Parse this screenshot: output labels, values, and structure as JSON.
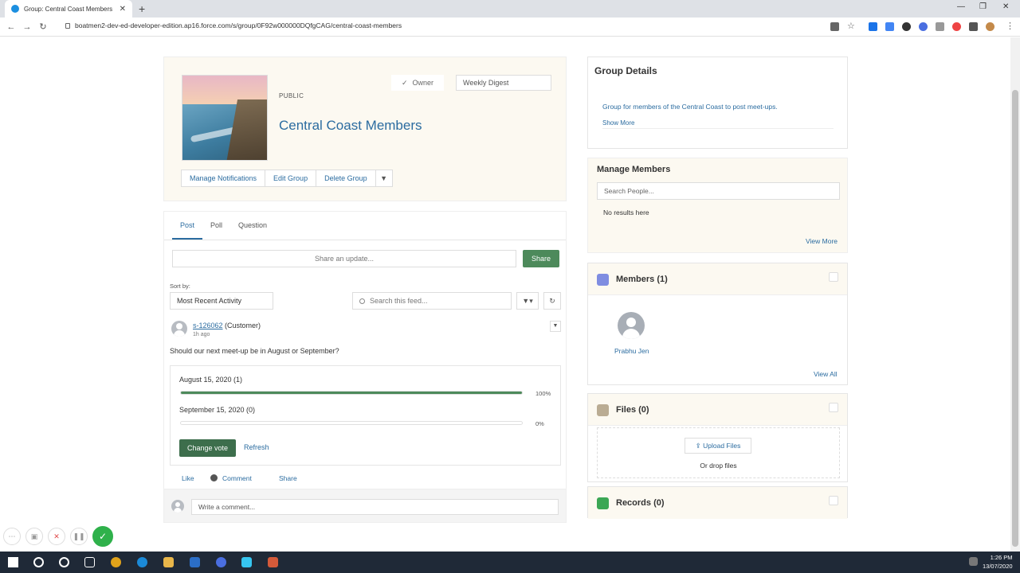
{
  "browser": {
    "tab_title": "Group: Central Coast Members",
    "url": "boatmen2-dev-ed-developer-edition.ap16.force.com/s/group/0F92w000000DQfgCAG/central-coast-members",
    "colors": {
      "accent": "#1c8fe0"
    }
  },
  "group": {
    "visibility": "PUBLIC",
    "name": "Central Coast Members",
    "owner_label": "Owner",
    "digest": "Weekly Digest",
    "actions": [
      "Manage Notifications",
      "Edit Group",
      "Delete Group"
    ]
  },
  "feed": {
    "tabs": [
      "Post",
      "Poll",
      "Question"
    ],
    "share_placeholder": "Share an update...",
    "share_label": "Share",
    "sort_label": "Sort by:",
    "sort_value": "Most Recent Activity",
    "search_placeholder": "Search this feed...",
    "post": {
      "author": "s-126062",
      "author_role": "(Customer)",
      "time": "1h ago",
      "text": "Should our next meet-up be in August or September?",
      "poll": {
        "options": [
          {
            "label": "August 15, 2020 (1)",
            "percent": 100,
            "percent_label": "100%"
          },
          {
            "label": "September 15, 2020 (0)",
            "percent": 0,
            "percent_label": "0%"
          }
        ],
        "change_vote_label": "Change vote",
        "refresh_label": "Refresh"
      },
      "actions": {
        "like": "Like",
        "comment": "Comment",
        "share": "Share"
      }
    },
    "comment_placeholder": "Write a comment..."
  },
  "details": {
    "title": "Group Details",
    "description": "Group for members of the Central Coast to post meet-ups.",
    "show_more": "Show More"
  },
  "manage_members": {
    "title": "Manage Members",
    "search_placeholder": "Search People...",
    "no_results": "No results here",
    "view_more": "View More"
  },
  "members": {
    "title": "Members (1)",
    "list": [
      {
        "name": "Prabhu Jen"
      }
    ],
    "view_all": "View All"
  },
  "files": {
    "title": "Files (0)",
    "upload_label": "Upload Files",
    "drop_label": "Or drop files"
  },
  "records": {
    "title": "Records (0)"
  },
  "taskbar": {
    "time": "1:26 PM",
    "date": "13/07/2020"
  },
  "colors": {
    "primary_green": "#4d8a5b",
    "link_blue": "#2b6ca0",
    "header_beige": "#fcf9f1"
  }
}
